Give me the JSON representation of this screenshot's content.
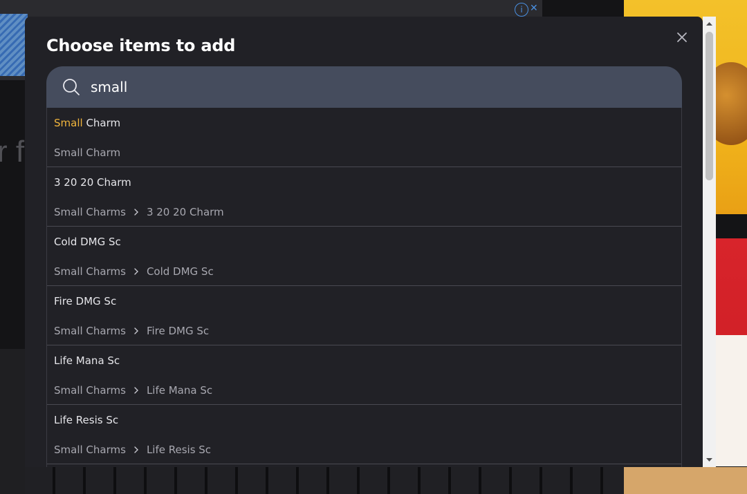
{
  "dialog": {
    "title": "Choose items to add",
    "close_icon": "close-icon"
  },
  "search": {
    "icon": "search-icon",
    "value": "small",
    "placeholder": ""
  },
  "results": [
    {
      "name_highlight": "Small",
      "name_rest": " Charm",
      "path_root": "Small Charm",
      "path_leaf": ""
    },
    {
      "name_highlight": "",
      "name_rest": "3 20 20 Charm",
      "path_root": "Small Charms",
      "path_leaf": "3 20 20 Charm"
    },
    {
      "name_highlight": "",
      "name_rest": "Cold DMG Sc",
      "path_root": "Small Charms",
      "path_leaf": "Cold DMG Sc"
    },
    {
      "name_highlight": "",
      "name_rest": "Fire DMG Sc",
      "path_root": "Small Charms",
      "path_leaf": "Fire DMG Sc"
    },
    {
      "name_highlight": "",
      "name_rest": "Life Mana Sc",
      "path_root": "Small Charms",
      "path_leaf": "Life Mana Sc"
    },
    {
      "name_highlight": "",
      "name_rest": "Life Resis Sc",
      "path_root": "Small Charms",
      "path_leaf": "Life Resis Sc"
    }
  ],
  "colors": {
    "dialog_bg": "#212126",
    "search_bg": "#454c5d",
    "highlight": "#f0b43c",
    "text_primary": "#e6e6ea",
    "text_secondary": "#a8a8b0"
  },
  "background": {
    "page_partial_text": "r fo"
  }
}
